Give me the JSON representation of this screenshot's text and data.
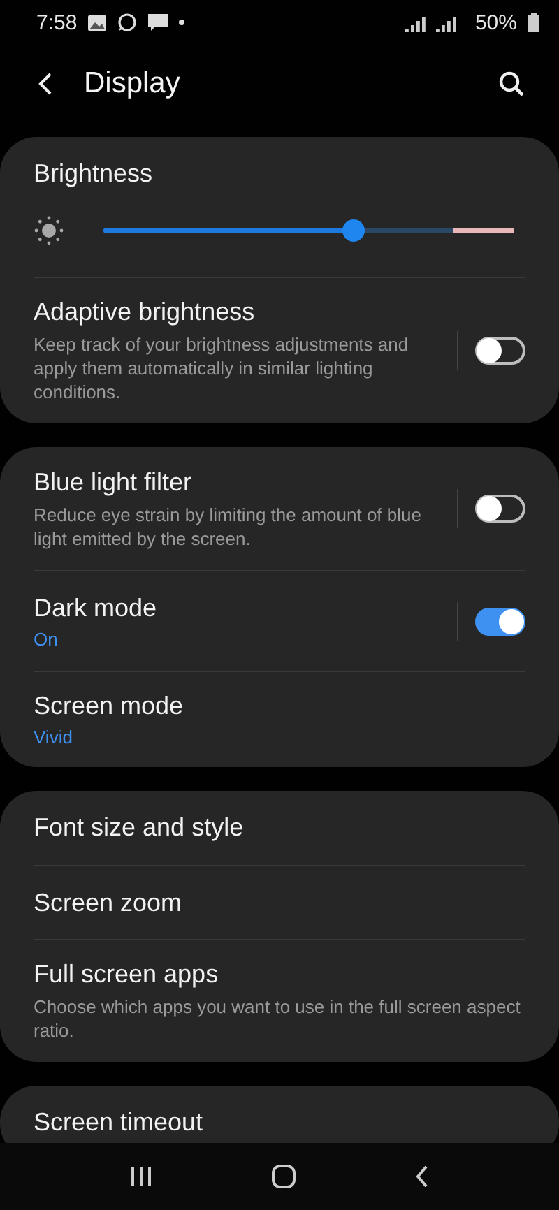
{
  "status_bar": {
    "time": "7:58",
    "battery": "50%"
  },
  "header": {
    "title": "Display"
  },
  "cards": [
    {
      "items": [
        {
          "kind": "slider",
          "title": "Brightness",
          "level": 0.61
        },
        {
          "kind": "switch",
          "title": "Adaptive brightness",
          "description": "Keep track of your brightness adjustments and apply them automatically in similar lighting conditions.",
          "on": false
        }
      ]
    },
    {
      "items": [
        {
          "kind": "switch",
          "title": "Blue light filter",
          "description": "Reduce eye strain by limiting the amount of blue light emitted by the screen.",
          "on": false
        },
        {
          "kind": "switch",
          "title": "Dark mode",
          "value": "On",
          "on": true
        },
        {
          "kind": "link",
          "title": "Screen mode",
          "value": "Vivid"
        }
      ]
    },
    {
      "items": [
        {
          "kind": "link",
          "title": "Font size and style"
        },
        {
          "kind": "link",
          "title": "Screen zoom"
        },
        {
          "kind": "link",
          "title": "Full screen apps",
          "description": "Choose which apps you want to use in the full screen aspect ratio."
        }
      ]
    },
    {
      "items": [
        {
          "kind": "link",
          "title": "Screen timeout"
        }
      ]
    }
  ]
}
